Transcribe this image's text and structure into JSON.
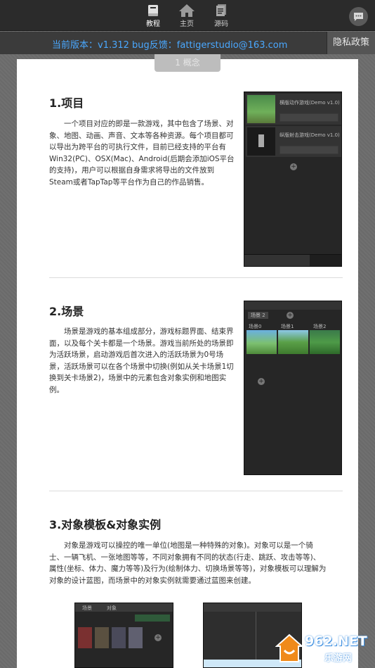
{
  "nav": {
    "tabs": [
      {
        "label": "教程",
        "icon": "book-icon",
        "active": true
      },
      {
        "label": "主页",
        "icon": "home-icon",
        "active": false
      },
      {
        "label": "源码",
        "icon": "document-icon",
        "active": false
      }
    ],
    "chat_icon": "chat-bubble-icon"
  },
  "infobar": {
    "version_text": "当前版本：v1.312  bug反馈：fattigerstudio@163.com",
    "privacy_label": "隐私政策"
  },
  "chapter_tab": "1 概念",
  "sections": [
    {
      "title": "1.项目",
      "body": "一个项目对应的即是一款游戏，其中包含了场景、对象、地图、动画、声音、文本等各种资源。每个项目都可以导出为跨平台的可执行文件，目前已经支持的平台有Win32(PC)、OSX(Mac)、Android(后期会添加iOS平台的支持)，用户可以根据自身需求将导出的文件放到Steam或者TapTap等平台作为自己的作品销售。"
    },
    {
      "title": "2.场景",
      "body": "场景是游戏的基本组成部分，游戏标题界面、结束界面，以及每个关卡都是一个场景。游戏当前所处的场景即为活跃场景，启动游戏后首次进入的活跃场景为0号场景，活跃场景可以在各个场景中切换(例如从关卡场景1切换到关卡场景2)，场景中的元素包含对象实例和地图实例。"
    },
    {
      "title": "3.对象模板&对象实例",
      "body": "对象是游戏可以操控的唯一单位(地图是一种特殊的对象)。对象可以是一个骑士、一辆飞机、一张地图等等，不同对象拥有不同的状态(行走、跳跃、攻击等等)、属性(坐标、体力、魔力等等)及行为(绘制体力、切换场景等等)，对象模板可以理解为对象的设计蓝图，而场景中的对象实例就需要通过蓝图来创建。"
    }
  ],
  "shot1": {
    "items": [
      {
        "name": "横版动作游戏(Demo v1.0)"
      },
      {
        "name": "纵版射击游戏(Demo v1.0)"
      }
    ]
  },
  "shot2": {
    "tabs": [
      "场景 2",
      "场景0",
      "场景1",
      "场景2"
    ]
  },
  "shot3": {
    "header": [
      "场景",
      "对象"
    ]
  },
  "watermark": {
    "brand": "962.NET",
    "sub": "乐游网"
  }
}
